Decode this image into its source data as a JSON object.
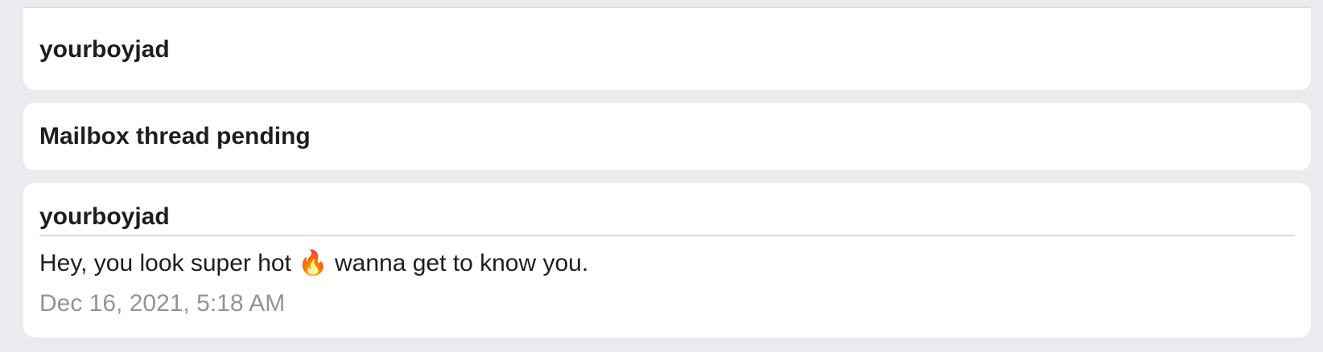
{
  "header": {
    "username": "yourboyjad"
  },
  "status": {
    "text": "Mailbox thread pending"
  },
  "message": {
    "sender": "yourboyjad",
    "body": "Hey, you look super hot 🔥 wanna get to know you.",
    "timestamp": "Dec 16, 2021, 5:18 AM"
  },
  "colors": {
    "background": "#e9ebee",
    "card": "#ffffff",
    "text": "#1c1e21",
    "muted": "#90949c"
  }
}
